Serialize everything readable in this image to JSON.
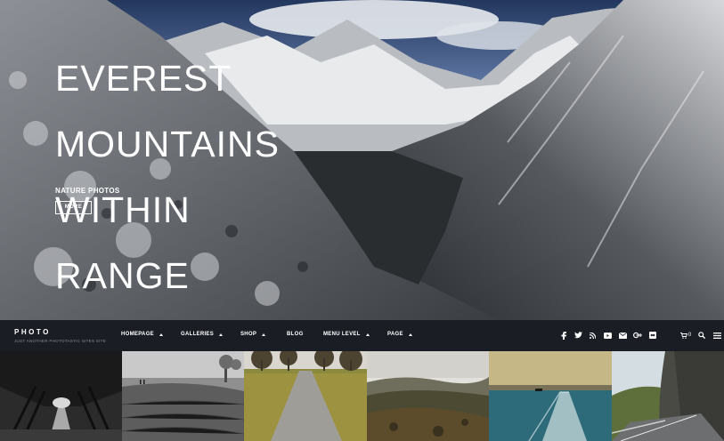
{
  "hero": {
    "title_lines": [
      "EVEREST",
      "MOUNTAINS",
      "WITHIN",
      "RANGE"
    ],
    "category": "NATURE PHOTOS",
    "more_label": "MORE"
  },
  "site": {
    "logo": "PHOTO",
    "tagline": "JUST ANOTHER PHOTOTASTIC SITES SITE"
  },
  "menu": [
    {
      "label": "HOMEPAGE",
      "has_dropdown": true
    },
    {
      "label": "GALLERIES",
      "has_dropdown": true
    },
    {
      "label": "SHOP",
      "has_dropdown": true
    },
    {
      "label": "BLOG",
      "has_dropdown": false
    },
    {
      "label": "MENU LEVEL",
      "has_dropdown": true
    },
    {
      "label": "PAGE",
      "has_dropdown": true
    }
  ],
  "social_icons": [
    "facebook-icon",
    "twitter-icon",
    "rss-icon",
    "youtube-icon",
    "email-icon",
    "google-plus-icon",
    "flickr-icon"
  ],
  "cart": {
    "count": "0"
  },
  "thumbnails": [
    "tree-tunnel-road",
    "foggy-field",
    "tree-lined-path",
    "valley-landscape",
    "harbor-wake",
    "highway-cliff"
  ]
}
